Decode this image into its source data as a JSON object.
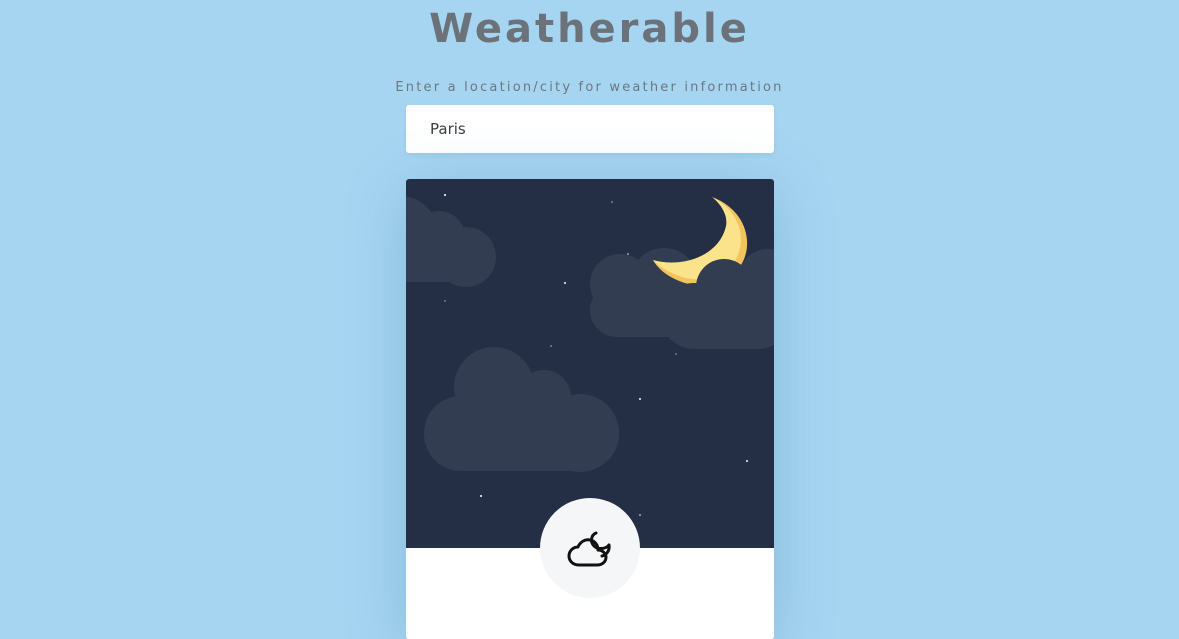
{
  "app": {
    "title": "Weatherable"
  },
  "search": {
    "label": "Enter a location/city for weather information",
    "value": "Paris"
  },
  "scene": {
    "sky_color": "#242f46",
    "cloud_color": "#323d52",
    "moon_color": "#fbe38c",
    "moon_shadow_color": "#f3c45e"
  },
  "condition": {
    "icon": "cloudy-night-icon"
  }
}
